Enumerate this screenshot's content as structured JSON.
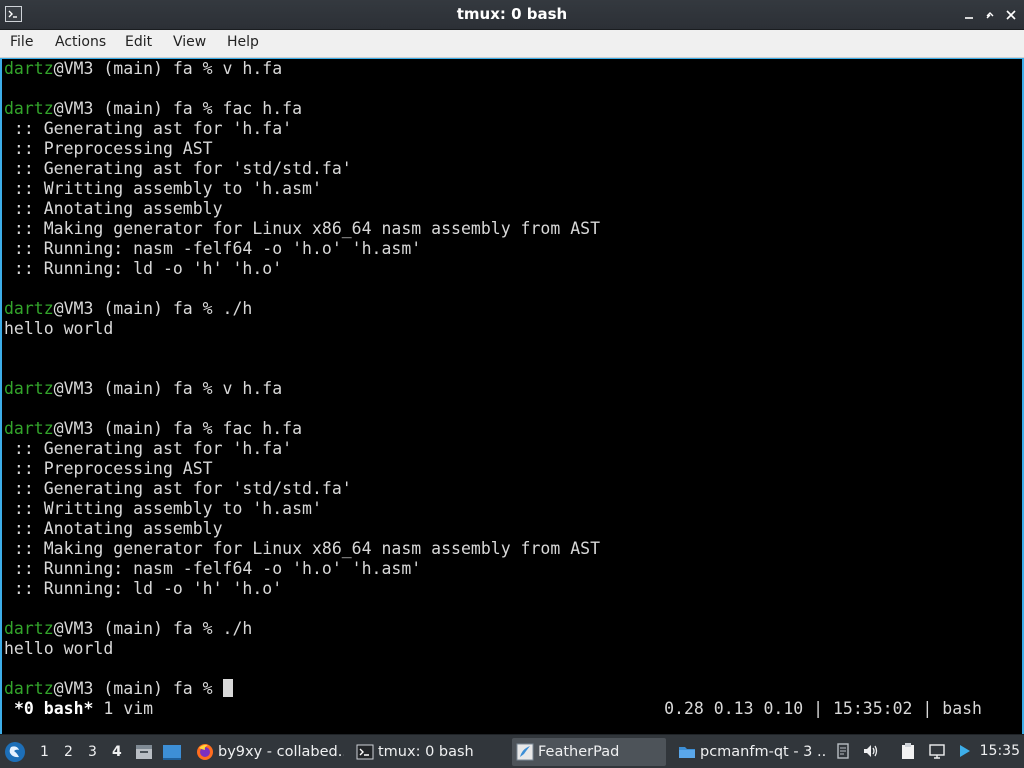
{
  "window": {
    "title": "tmux: 0 bash",
    "app_icon": "terminal-icon",
    "controls": [
      "minimize-icon",
      "maximize-icon",
      "close-icon"
    ]
  },
  "menu": [
    "File",
    "Actions",
    "Edit",
    "View",
    "Help"
  ],
  "terminal": {
    "lines": [
      {
        "user": "dartz",
        "text": "@VM3 (main) fa % v h.fa"
      },
      {
        "user": "",
        "text": ""
      },
      {
        "user": "dartz",
        "text": "@VM3 (main) fa % fac h.fa"
      },
      {
        "user": "",
        "text": " :: Generating ast for 'h.fa'"
      },
      {
        "user": "",
        "text": " :: Preprocessing AST"
      },
      {
        "user": "",
        "text": " :: Generating ast for 'std/std.fa'"
      },
      {
        "user": "",
        "text": " :: Writting assembly to 'h.asm'"
      },
      {
        "user": "",
        "text": " :: Anotating assembly"
      },
      {
        "user": "",
        "text": " :: Making generator for Linux x86_64 nasm assembly from AST"
      },
      {
        "user": "",
        "text": " :: Running: nasm -felf64 -o 'h.o' 'h.asm'"
      },
      {
        "user": "",
        "text": " :: Running: ld -o 'h' 'h.o'"
      },
      {
        "user": "",
        "text": ""
      },
      {
        "user": "dartz",
        "text": "@VM3 (main) fa % ./h"
      },
      {
        "user": "",
        "text": "hello world"
      },
      {
        "user": "",
        "text": ""
      },
      {
        "user": "",
        "text": ""
      },
      {
        "user": "dartz",
        "text": "@VM3 (main) fa % v h.fa"
      },
      {
        "user": "",
        "text": ""
      },
      {
        "user": "dartz",
        "text": "@VM3 (main) fa % fac h.fa"
      },
      {
        "user": "",
        "text": " :: Generating ast for 'h.fa'"
      },
      {
        "user": "",
        "text": " :: Preprocessing AST"
      },
      {
        "user": "",
        "text": " :: Generating ast for 'std/std.fa'"
      },
      {
        "user": "",
        "text": " :: Writting assembly to 'h.asm'"
      },
      {
        "user": "",
        "text": " :: Anotating assembly"
      },
      {
        "user": "",
        "text": " :: Making generator for Linux x86_64 nasm assembly from AST"
      },
      {
        "user": "",
        "text": " :: Running: nasm -felf64 -o 'h.o' 'h.asm'"
      },
      {
        "user": "",
        "text": " :: Running: ld -o 'h' 'h.o'"
      },
      {
        "user": "",
        "text": ""
      },
      {
        "user": "dartz",
        "text": "@VM3 (main) fa % ./h"
      },
      {
        "user": "",
        "text": "hello world"
      },
      {
        "user": "",
        "text": ""
      },
      {
        "user": "dartz",
        "text": "@VM3 (main) fa % "
      }
    ],
    "status": {
      "active_window": "*0 bash*",
      "other_window": " 1 vim",
      "right": "0.28 0.13 0.10 | 15:35:02 | bash"
    }
  },
  "taskbar": {
    "workspaces": [
      "1",
      "2",
      "3",
      "4"
    ],
    "current_workspace": "4",
    "tasks": [
      {
        "label": "by9xy - collabed...",
        "icon": "firefox-icon"
      },
      {
        "label": "tmux: 0 bash",
        "icon": "terminal-icon"
      },
      {
        "label": "FeatherPad",
        "icon": "featherpad-icon"
      },
      {
        "label": "pcmanfm-qt - 3 ...",
        "icon": "folder-icon"
      }
    ],
    "clock": "15:35",
    "colors": {
      "accent": "#3daee9",
      "prompt_user": "#33a52b",
      "panel": "#31363b"
    }
  }
}
